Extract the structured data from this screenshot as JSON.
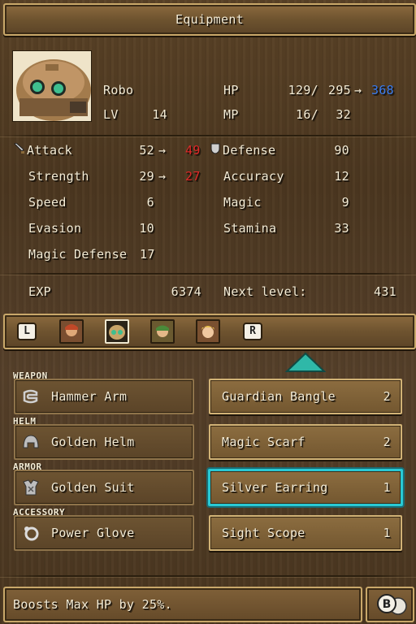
{
  "header": {
    "title": "Equipment"
  },
  "character": {
    "name": "Robo",
    "lv_label": "LV",
    "lv": "14",
    "hp_label": "HP",
    "hp_current": "129/",
    "hp_max": "295",
    "hp_arrow": "→",
    "hp_new": "368",
    "mp_label": "MP",
    "mp_current": "16/",
    "mp_max": "32"
  },
  "stats": {
    "attack": {
      "label": "Attack",
      "value": "52",
      "arrow": "→",
      "new": "49"
    },
    "defense": {
      "label": "Defense",
      "value": "90"
    },
    "strength": {
      "label": "Strength",
      "value": "29",
      "arrow": "→",
      "new": "27"
    },
    "accuracy": {
      "label": "Accuracy",
      "value": "12"
    },
    "speed": {
      "label": "Speed",
      "value": "6"
    },
    "magic": {
      "label": "Magic",
      "value": "9"
    },
    "evasion": {
      "label": "Evasion",
      "value": "10"
    },
    "stamina": {
      "label": "Stamina",
      "value": "33"
    },
    "magic_defense": {
      "label": "Magic Defense",
      "value": "17"
    }
  },
  "experience": {
    "exp_label": "EXP",
    "exp_value": "6374",
    "next_label": "Next level:",
    "next_value": "431"
  },
  "party": {
    "left_button": "L",
    "right_button": "R",
    "members": [
      "member-1-icon",
      "robo-icon",
      "member-3-icon",
      "member-4-icon"
    ],
    "selected_index": 1
  },
  "slots": [
    {
      "category": "WEAPON",
      "icon": "robot-arm-icon",
      "name": "Hammer Arm"
    },
    {
      "category": "HELM",
      "icon": "helmet-icon",
      "name": "Golden Helm"
    },
    {
      "category": "ARMOR",
      "icon": "armor-icon",
      "name": "Golden Suit"
    },
    {
      "category": "ACCESSORY",
      "icon": "glove-icon",
      "name": "Power Glove"
    }
  ],
  "inventory": [
    {
      "name": "Guardian Bangle",
      "qty": "2"
    },
    {
      "name": "Magic Scarf",
      "qty": "2"
    },
    {
      "name": "Silver Earring",
      "qty": "1"
    },
    {
      "name": "Sight Scope",
      "qty": "1"
    }
  ],
  "selected_inventory_index": 2,
  "footer": {
    "description": "Boosts Max HP by 25%.",
    "back_button": "B"
  },
  "colors": {
    "accent_selected": "#29c9d4",
    "decrease": "#e02828",
    "increase": "#3a7cf0",
    "scroll_arrow": "#2fb8a8"
  }
}
